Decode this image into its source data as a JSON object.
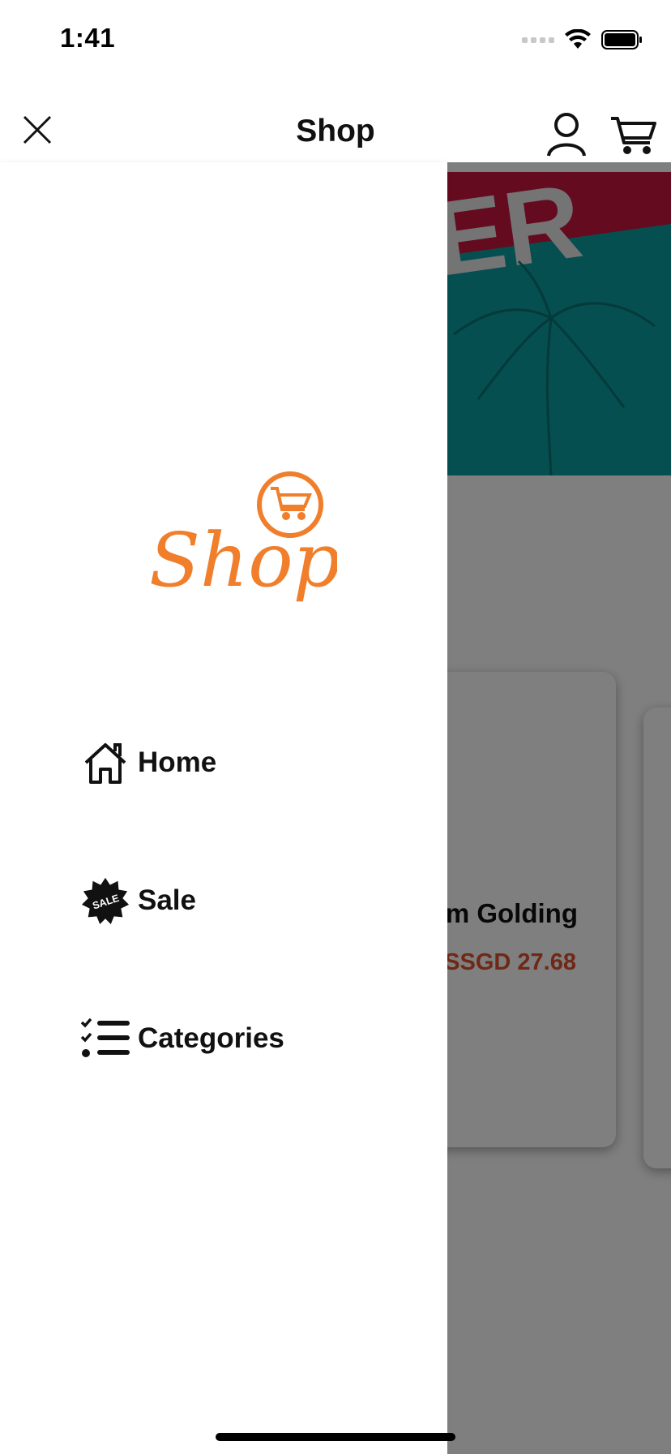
{
  "status_bar": {
    "time": "1:41",
    "icons": [
      "cellular-signal-icon",
      "wifi-icon",
      "battery-icon"
    ]
  },
  "nav": {
    "title": "Shop",
    "close_icon": "close-icon",
    "user_icon": "user-icon",
    "cart_icon": "cart-icon"
  },
  "drawer": {
    "logo_text": "Shop",
    "items": [
      {
        "label": "Home",
        "icon": "home-icon"
      },
      {
        "label": "Sale",
        "icon": "sale-badge-icon"
      },
      {
        "label": "Categories",
        "icon": "checklist-icon"
      }
    ]
  },
  "background": {
    "banner_letters": "ER",
    "product": {
      "name": "m Golding",
      "price": "SSGD 27.68"
    }
  },
  "colors": {
    "brand_orange": "#f07e2b",
    "price_red": "#e0502c",
    "banner_red": "#c8163f",
    "banner_teal": "#0a9ea0",
    "overlay": "rgba(0,0,0,0.5)"
  }
}
